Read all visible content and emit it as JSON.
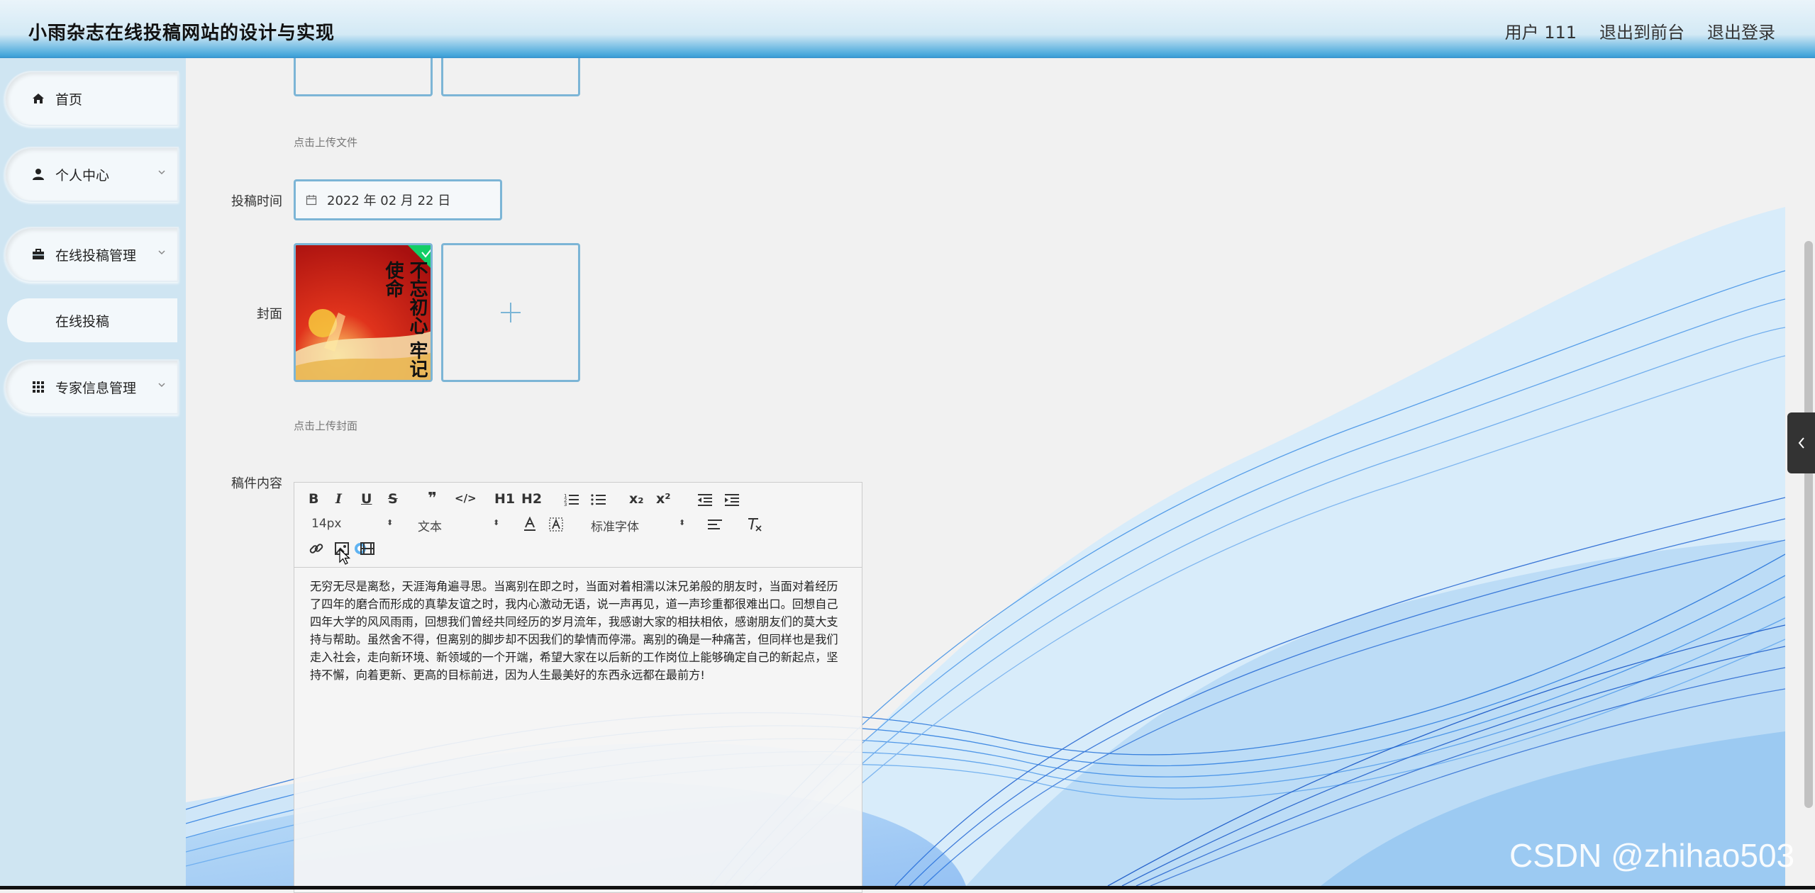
{
  "app": {
    "title": "小雨杂志在线投稿网站的设计与实现"
  },
  "topnav": {
    "user": "用户 111",
    "back_front": "退出到前台",
    "logout": "退出登录"
  },
  "sidebar": {
    "items": [
      {
        "label": "首页",
        "icon": "home-icon"
      },
      {
        "label": "个人中心",
        "icon": "user-icon"
      },
      {
        "label": "在线投稿管理",
        "icon": "briefcase-icon"
      },
      {
        "label": "在线投稿",
        "icon": ""
      },
      {
        "label": "专家信息管理",
        "icon": "grid-icon"
      }
    ]
  },
  "form": {
    "file_hint": "点击上传文件",
    "date_label": "投稿时间",
    "date_value": "2022 年 02 月 22 日",
    "cover_label": "封面",
    "cover_hint": "点击上传封面",
    "content_label": "稿件内容",
    "cover_text": "不忘初心 牢记使命"
  },
  "editor": {
    "toolbar": {
      "bold": "B",
      "italic": "I",
      "underline": "U",
      "strike": "S",
      "quote": "❞",
      "code": "</>",
      "h1": "H1",
      "h2": "H2",
      "sub": "x₂",
      "sup": "x²",
      "font_size": "14px",
      "header": "文本",
      "font_family": "标准字体"
    },
    "content": "无穷无尽是离愁，天涯海角遍寻思。当离别在即之时，当面对着相濡以沫兄弟般的朋友时，当面对着经历了四年的磨合而形成的真挚友谊之时，我内心激动无语，说一声再见，道一声珍重都很难出口。回想自己四年大学的风风雨雨，回想我们曾经共同经历的岁月流年，我感谢大家的相扶相依，感谢朋友们的莫大支持与帮助。虽然舍不得，但离别的脚步却不因我们的挚情而停滞。离别的确是一种痛苦，但同样也是我们走入社会，走向新环境、新领域的一个开端，希望大家在以后新的工作岗位上能够确定自己的新起点，坚持不懈，向着更新、更高的目标前进，因为人生最美好的东西永远都在最前方!"
  },
  "watermark": "CSDN @zhihao503",
  "colors": {
    "accent": "#7cb5d6",
    "header_gradient_bottom": "#3a9ad2",
    "sidebar_bg": "#cfe5f2"
  }
}
